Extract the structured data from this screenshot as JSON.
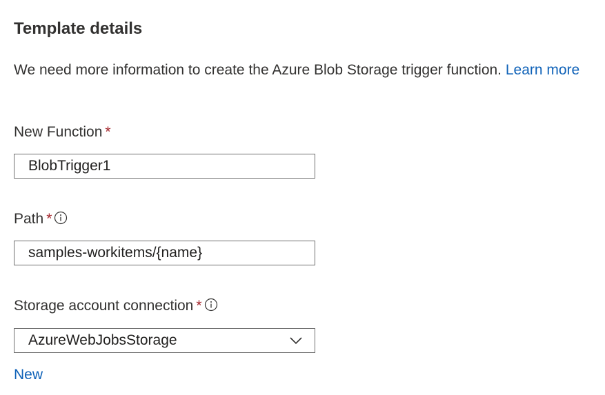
{
  "section": {
    "title": "Template details"
  },
  "description": {
    "text": "We need more information to create the Azure Blob Storage trigger function. ",
    "link_label": "Learn more"
  },
  "fields": {
    "new_function": {
      "label": "New Function",
      "required_mark": "*",
      "value": "BlobTrigger1"
    },
    "path": {
      "label": "Path",
      "required_mark": "*",
      "value": "samples-workitems/{name}"
    },
    "storage_connection": {
      "label": "Storage account connection",
      "required_mark": "*",
      "selected": "AzureWebJobsStorage",
      "new_link_label": "New"
    }
  },
  "colors": {
    "link": "#0f62b8",
    "required": "#a4262c",
    "border": "#6e6e6e",
    "text": "#323130"
  },
  "icons": {
    "info": "info-icon",
    "dropdown": "chevron-down-icon"
  }
}
